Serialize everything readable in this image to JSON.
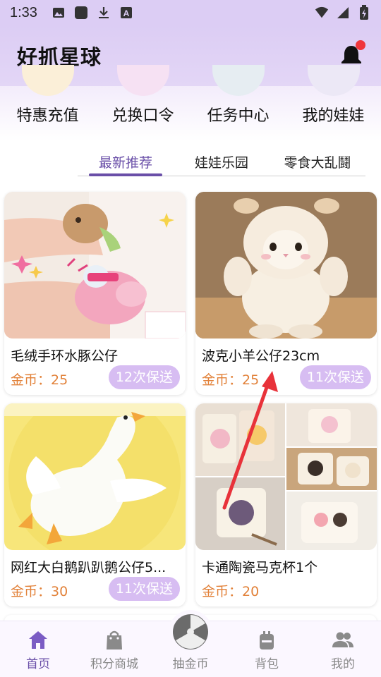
{
  "status_bar": {
    "time": "1:33",
    "left_icons": [
      "image-icon",
      "app-square-icon",
      "download-icon",
      "font-a-icon"
    ],
    "right_icons": [
      "wifi-icon",
      "signal-icon",
      "battery-icon"
    ]
  },
  "header": {
    "title": "好抓星球",
    "notification_dot": true
  },
  "quick_actions": [
    {
      "label": "特惠充值",
      "color": "#fbefd8"
    },
    {
      "label": "兑换口令",
      "color": "#f6e1f3"
    },
    {
      "label": "任务中心",
      "color": "#e6edf2"
    },
    {
      "label": "我的娃娃",
      "color": "#ece8f6"
    }
  ],
  "tabs": [
    {
      "label": "最新推荐",
      "active": true
    },
    {
      "label": "娃娃乐园",
      "active": false
    },
    {
      "label": "零食大乱鬪",
      "active": false
    }
  ],
  "products": [
    {
      "name": "毛绒手环水豚公仔",
      "price": "金币：25",
      "badge": "12次保送"
    },
    {
      "name": "波克小羊公仔23cm",
      "price": "金币：25",
      "badge": "11次保送"
    },
    {
      "name": "网红大白鹅趴趴鹅公仔5...",
      "price": "金币：30",
      "badge": "11次保送"
    },
    {
      "name": "卡通陶瓷马克杯1个",
      "price": "金币：20",
      "badge": ""
    }
  ],
  "bottom_nav": [
    {
      "label": "首页",
      "icon": "home-icon",
      "active": true
    },
    {
      "label": "积分商城",
      "icon": "shopping-bag-icon",
      "active": false
    },
    {
      "label": "抽金币",
      "icon": "claw-ball-icon",
      "active": false
    },
    {
      "label": "背包",
      "icon": "backpack-icon",
      "active": false
    },
    {
      "label": "我的",
      "icon": "people-icon",
      "active": false
    }
  ],
  "colors": {
    "accent": "#6a4fa8",
    "header_bg": "#dccdf4",
    "price": "#e2823a",
    "badge_bg": "#d7bdf2",
    "annotation_arrow": "#e8323a"
  }
}
